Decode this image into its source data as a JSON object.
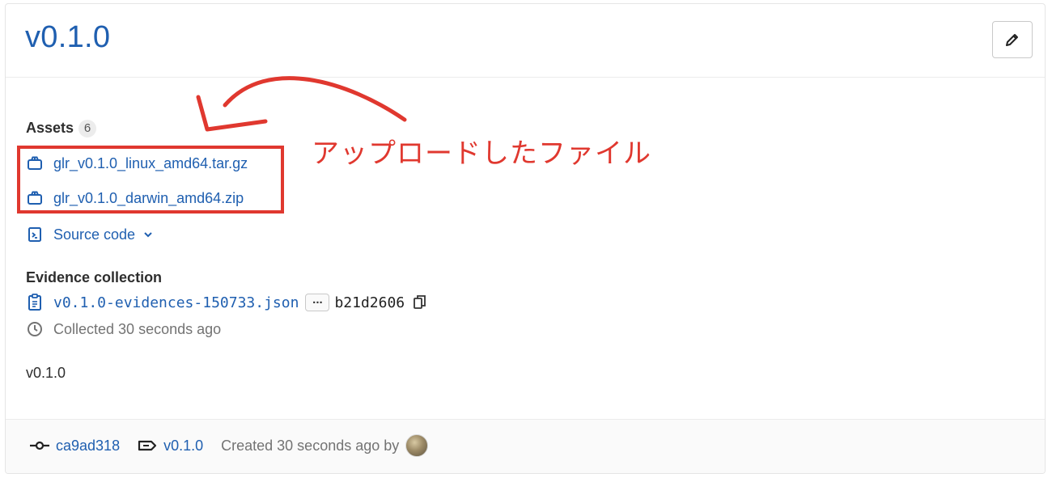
{
  "release": {
    "title": "v0.1.0",
    "edit_icon": "pencil-icon"
  },
  "assets": {
    "heading": "Assets",
    "count": "6",
    "items": [
      {
        "icon": "package-icon",
        "label": "glr_v0.1.0_linux_amd64.tar.gz"
      },
      {
        "icon": "package-icon",
        "label": "glr_v0.1.0_darwin_amd64.zip"
      }
    ],
    "source_code": {
      "icon": "file-archive-icon",
      "label": "Source code",
      "chevron": "chevron-down-icon"
    }
  },
  "evidence": {
    "heading": "Evidence collection",
    "file": "v0.1.0-evidences-150733.json",
    "ellipsis": "...",
    "sha": "b21d2606",
    "collected": "Collected 30 seconds ago"
  },
  "description": "v0.1.0",
  "footer": {
    "commit": "ca9ad318",
    "tag": "v0.1.0",
    "created": "Created 30 seconds ago by"
  },
  "annotation": {
    "text": "アップロードしたファイル",
    "color": "#e0382f"
  },
  "colors": {
    "link": "#1f5fb0",
    "muted": "#737373"
  }
}
